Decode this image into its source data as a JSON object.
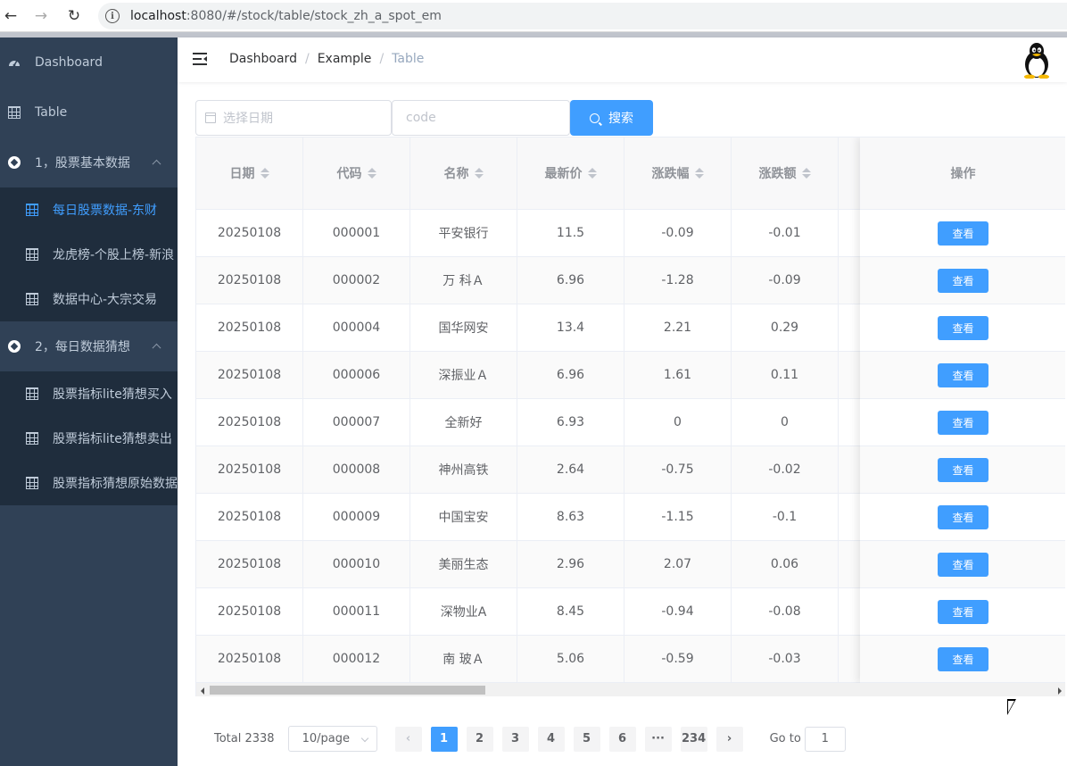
{
  "browser": {
    "url_host": "localhost",
    "url_rest": ":8080/#/stock/table/stock_zh_a_spot_em"
  },
  "sidebar": {
    "items": [
      {
        "label": "Dashboard",
        "icon": "dashboard-icon"
      },
      {
        "label": "Table",
        "icon": "table-icon"
      }
    ],
    "groups": [
      {
        "label": "1，股票基本数据",
        "icon": "circle-icon",
        "children": [
          {
            "label": "每日股票数据-东财",
            "active": true
          },
          {
            "label": "龙虎榜-个股上榜-新浪"
          },
          {
            "label": "数据中心-大宗交易"
          }
        ]
      },
      {
        "label": "2，每日数据猜想",
        "icon": "circle-icon",
        "children": [
          {
            "label": "股票指标lite猜想买入"
          },
          {
            "label": "股票指标lite猜想卖出"
          },
          {
            "label": "股票指标猜想原始数据"
          }
        ]
      }
    ]
  },
  "breadcrumb": [
    "Dashboard",
    "Example",
    "Table"
  ],
  "filters": {
    "date_placeholder": "选择日期",
    "code_placeholder": "code",
    "search_label": "搜索"
  },
  "table": {
    "columns": [
      "日期",
      "代码",
      "名称",
      "最新价",
      "涨跌幅",
      "涨跌额"
    ],
    "action_header": "操作",
    "action_label": "查看",
    "rows": [
      [
        "20250108",
        "000001",
        "平安银行",
        "11.5",
        "-0.09",
        "-0.01"
      ],
      [
        "20250108",
        "000002",
        "万 科Ａ",
        "6.96",
        "-1.28",
        "-0.09"
      ],
      [
        "20250108",
        "000004",
        "国华网安",
        "13.4",
        "2.21",
        "0.29"
      ],
      [
        "20250108",
        "000006",
        "深振业Ａ",
        "6.96",
        "1.61",
        "0.11"
      ],
      [
        "20250108",
        "000007",
        "全新好",
        "6.93",
        "0",
        "0"
      ],
      [
        "20250108",
        "000008",
        "神州高铁",
        "2.64",
        "-0.75",
        "-0.02"
      ],
      [
        "20250108",
        "000009",
        "中国宝安",
        "8.63",
        "-1.15",
        "-0.1"
      ],
      [
        "20250108",
        "000010",
        "美丽生态",
        "2.96",
        "2.07",
        "0.06"
      ],
      [
        "20250108",
        "000011",
        "深物业A",
        "8.45",
        "-0.94",
        "-0.08"
      ],
      [
        "20250108",
        "000012",
        "南 玻Ａ",
        "5.06",
        "-0.59",
        "-0.03"
      ]
    ]
  },
  "pagination": {
    "total": "Total 2338",
    "page_size": "10/page",
    "pages": [
      "1",
      "2",
      "3",
      "4",
      "5",
      "6",
      "···",
      "234"
    ],
    "current": "1",
    "goto_label": "Go to",
    "goto_value": "1"
  },
  "colors": {
    "accent": "#409eff",
    "sidebar_bg": "#304156",
    "submenu_bg": "#1f2d3d"
  }
}
